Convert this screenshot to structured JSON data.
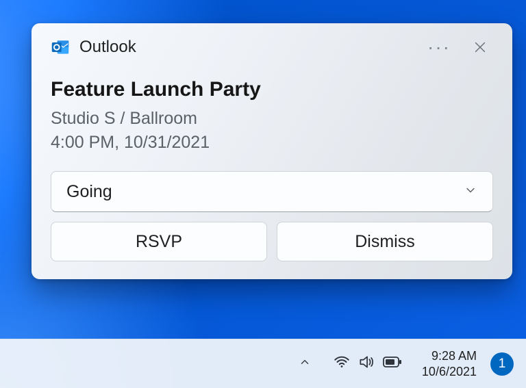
{
  "toast": {
    "app_name": "Outlook",
    "title": "Feature Launch Party",
    "location": "Studio S / Ballroom",
    "time": "4:00 PM, 10/31/2021",
    "dropdown_value": "Going",
    "actions": {
      "rsvp": "RSVP",
      "dismiss": "Dismiss"
    }
  },
  "taskbar": {
    "time": "9:28 AM",
    "date": "10/6/2021",
    "notification_count": "1"
  }
}
